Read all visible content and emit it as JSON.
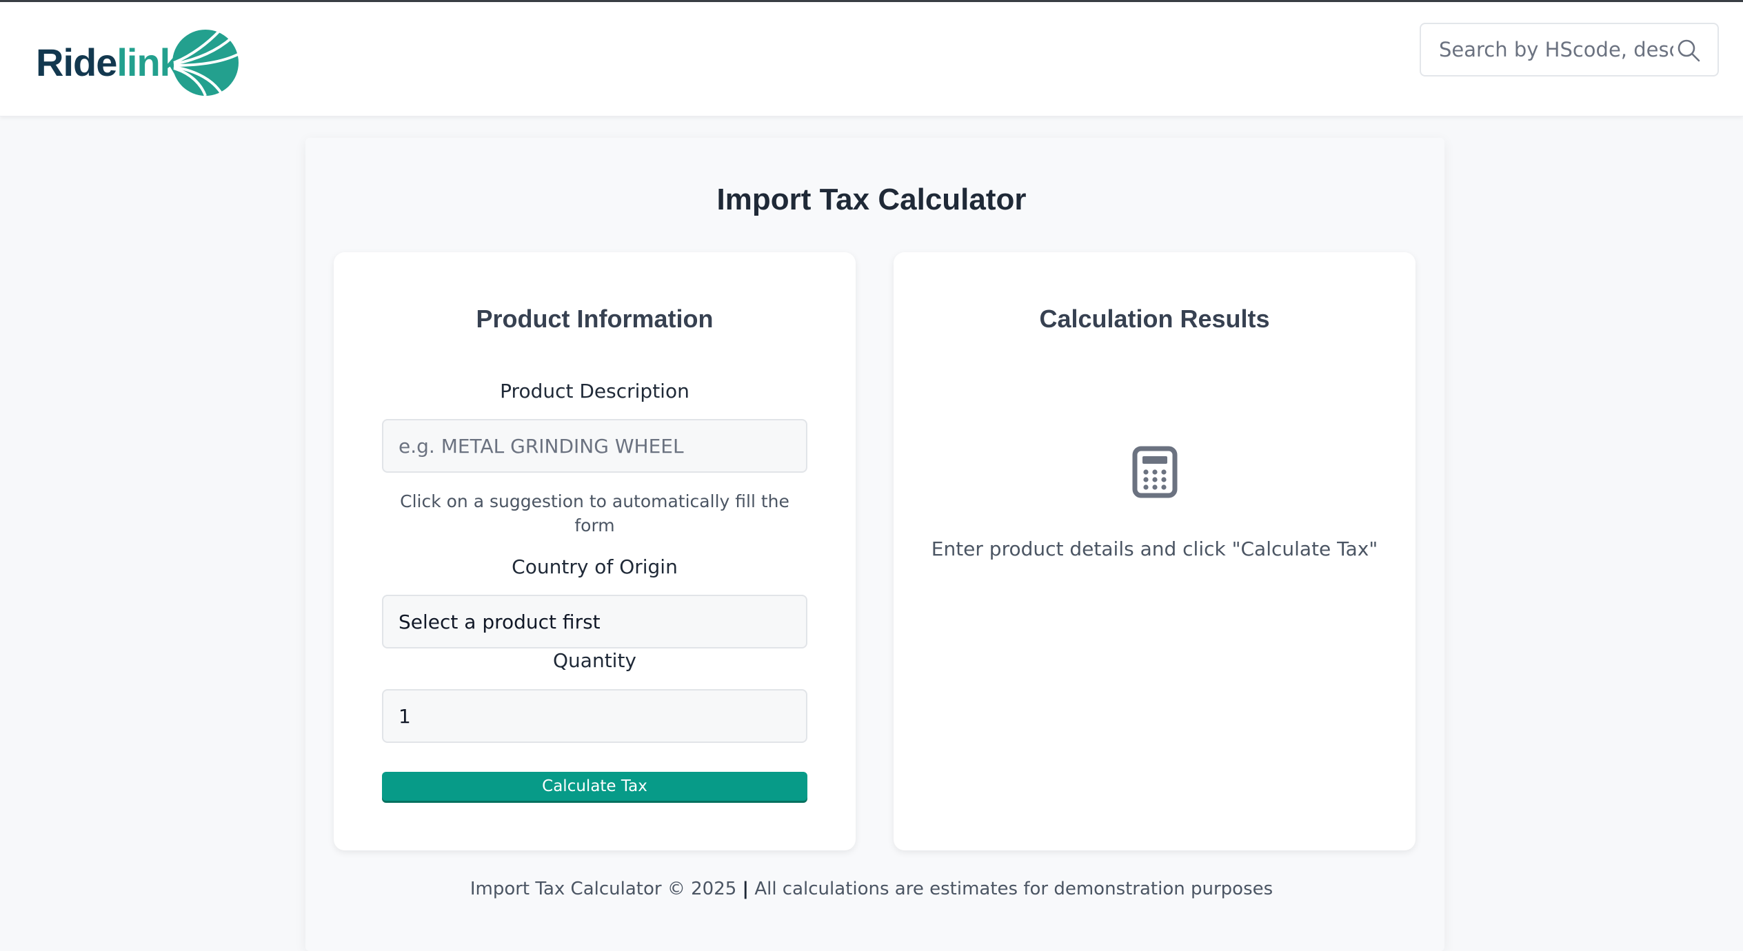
{
  "header": {
    "logo": {
      "text_part1": "Ride",
      "text_part2": "link",
      "brand_dark": "#13384f",
      "brand_teal": "#23a08e"
    },
    "search": {
      "placeholder": "Search by HScode, desc",
      "icon": "search-icon"
    }
  },
  "page": {
    "title": "Import Tax Calculator"
  },
  "product_panel": {
    "title": "Product Information",
    "description_label": "Product Description",
    "description_placeholder": "e.g. METAL GRINDING WHEEL",
    "description_hint": "Click on a suggestion to automatically fill the form",
    "country_label": "Country of Origin",
    "country_value": "Select a product first",
    "quantity_label": "Quantity",
    "quantity_value": "1",
    "calculate_button": "Calculate Tax",
    "accent": "#079b88"
  },
  "results_panel": {
    "title": "Calculation Results",
    "icon": "calculator-icon",
    "empty_message": "Enter product details and click \"Calculate Tax\""
  },
  "footer": {
    "text_left": "Import Tax Calculator © 2025",
    "separator": "|",
    "text_right": "All calculations are estimates for demonstration purposes"
  }
}
